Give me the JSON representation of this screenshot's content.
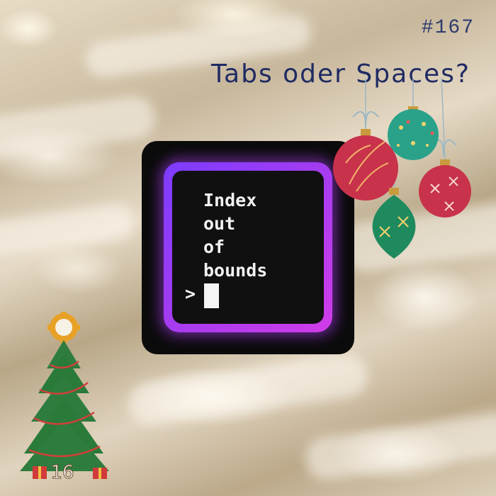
{
  "episode_number": "#167",
  "title": "Tabs oder Spaces?",
  "terminal": {
    "lines": [
      "Index",
      "out",
      "of",
      "bounds"
    ],
    "prompt_symbol": ">"
  },
  "tree": {
    "label": "16"
  },
  "colors": {
    "title": "#1f2b63",
    "terminal_border_start": "#7c3cff",
    "terminal_border_end": "#d13ce8",
    "terminal_bg": "#101010"
  }
}
